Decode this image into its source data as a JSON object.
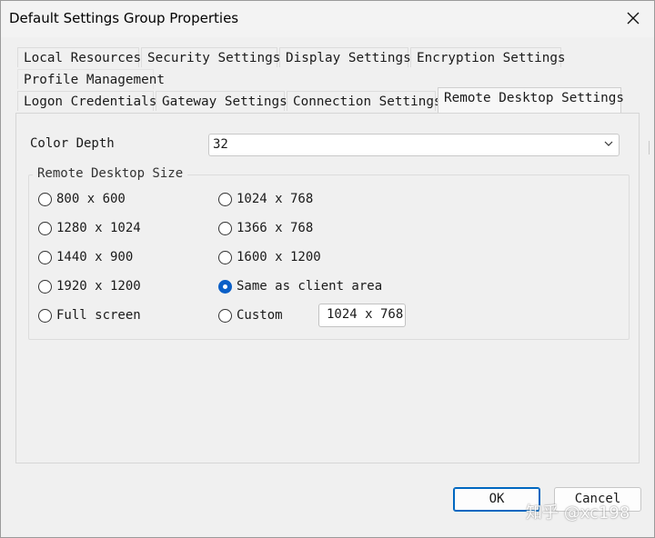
{
  "window": {
    "title": "Default Settings Group Properties"
  },
  "tabs": {
    "row1": [
      {
        "label": "Local Resources"
      },
      {
        "label": "Security Settings"
      },
      {
        "label": "Display Settings"
      },
      {
        "label": "Encryption Settings"
      }
    ],
    "row2": [
      {
        "label": "Profile Management"
      }
    ],
    "row3": [
      {
        "label": "Logon Credentials"
      },
      {
        "label": "Gateway Settings"
      },
      {
        "label": "Connection Settings"
      },
      {
        "label": "Remote Desktop Settings",
        "active": true
      }
    ]
  },
  "color_depth": {
    "label": "Color Depth",
    "value": "32"
  },
  "size_group": {
    "legend": "Remote Desktop Size",
    "options": [
      {
        "label": "800 x 600",
        "checked": false
      },
      {
        "label": "1024 x 768",
        "checked": false
      },
      {
        "label": "1280 x 1024",
        "checked": false
      },
      {
        "label": "1366 x 768",
        "checked": false
      },
      {
        "label": "1440 x 900",
        "checked": false
      },
      {
        "label": "1600 x 1200",
        "checked": false
      },
      {
        "label": "1920 x 1200",
        "checked": false
      },
      {
        "label": "Same as client area",
        "checked": true
      },
      {
        "label": "Full screen",
        "checked": false
      },
      {
        "label": "Custom",
        "checked": false
      }
    ],
    "custom_value": "1024 x 768"
  },
  "buttons": {
    "ok": "OK",
    "cancel": "Cancel"
  },
  "watermark": "知乎 @xc198",
  "colors": {
    "accent": "#0067c0",
    "radio_checked": "#0a5fc7"
  }
}
